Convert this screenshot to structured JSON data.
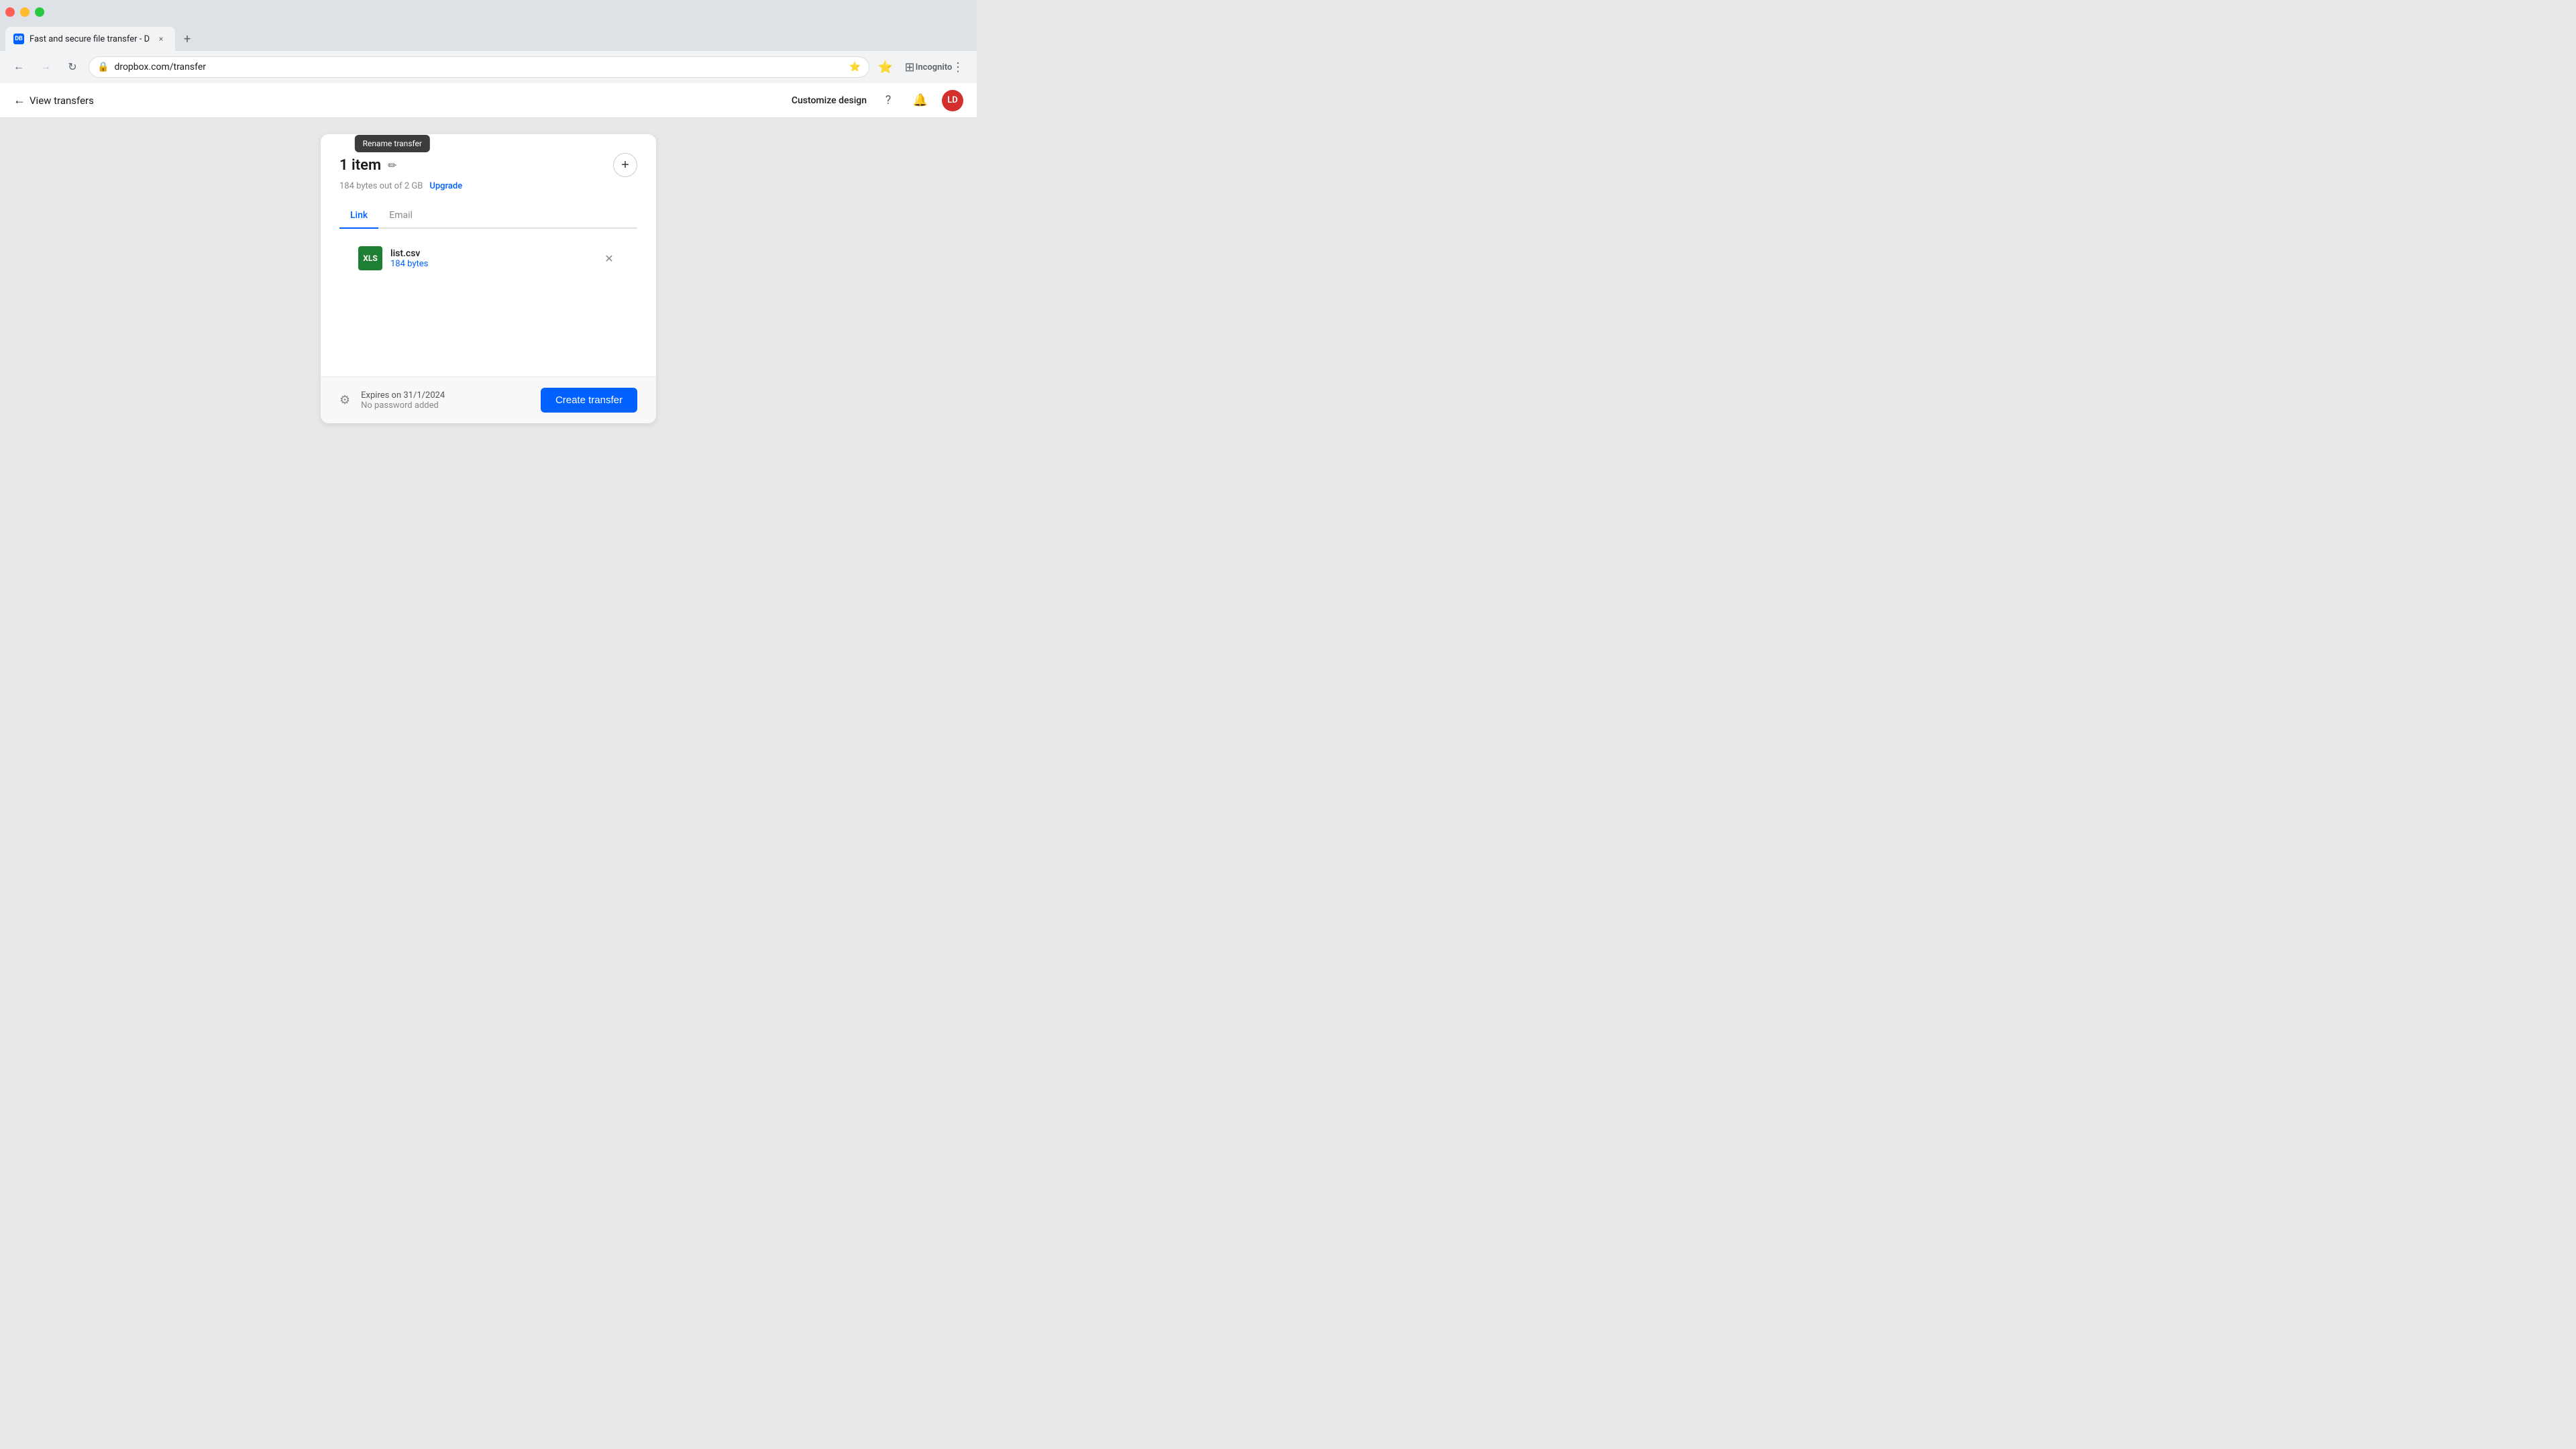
{
  "browser": {
    "tab": {
      "title": "Fast and secure file transfer - D",
      "favicon_text": "DB"
    },
    "address": "dropbox.com/transfer",
    "back_disabled": false,
    "forward_disabled": true,
    "incognito_label": "Incognito"
  },
  "header": {
    "back_label": "View transfers",
    "customize_label": "Customize design",
    "avatar_initials": "LD"
  },
  "transfer": {
    "title": "1 item",
    "subtitle": "184 bytes out of 2 GB",
    "upgrade_label": "Upgrade",
    "tooltip": "Rename transfer",
    "tabs": [
      {
        "label": "Link",
        "active": true
      },
      {
        "label": "Email",
        "active": false
      }
    ],
    "file": {
      "name": "list.csv",
      "size": "184 bytes",
      "icon_text": "XLS"
    },
    "footer": {
      "expires_label": "Expires on 31/1/2024",
      "password_label": "No password added",
      "create_btn_label": "Create transfer"
    }
  }
}
